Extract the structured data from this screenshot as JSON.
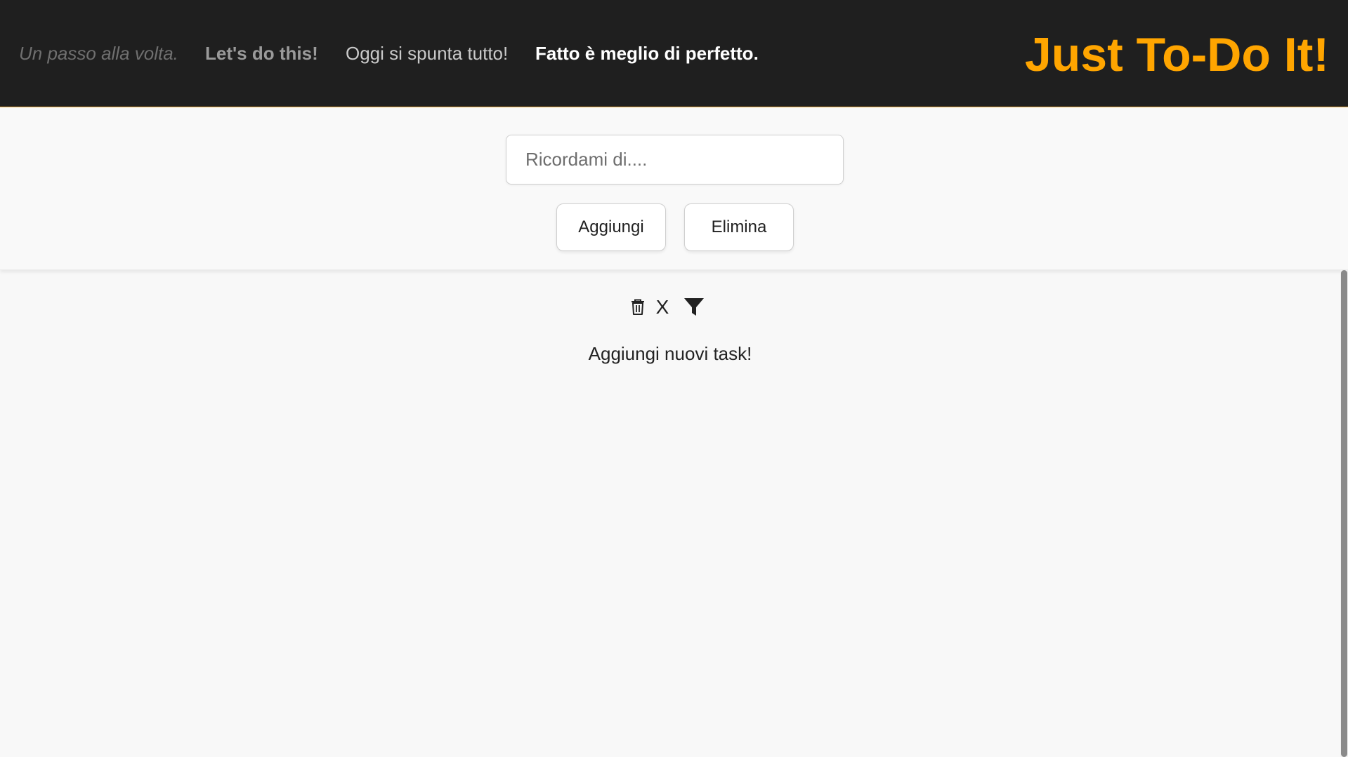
{
  "header": {
    "mottos": [
      "Un passo alla volta.",
      "Let's do this!",
      "Oggi si spunta tutto!",
      "Fatto è meglio di perfetto."
    ],
    "brand": "Just To-Do It!",
    "accent_color": "#ffa500",
    "background_color": "#1f1f1f"
  },
  "form": {
    "input_placeholder": "Ricordami di....",
    "input_value": "",
    "add_label": "Aggiungi",
    "delete_label": "Elimina"
  },
  "toolbar": {
    "icons": [
      "trash-icon",
      "close-icon",
      "filter-icon"
    ],
    "close_label": "X"
  },
  "list": {
    "empty_message": "Aggiungi nuovi task!",
    "items": []
  }
}
